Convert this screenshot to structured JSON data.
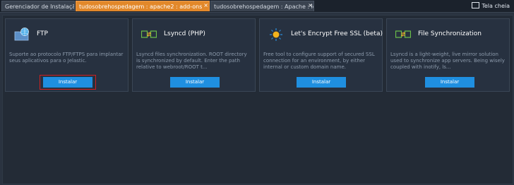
{
  "tabs": [
    {
      "label": "Gerenciador de Instalação",
      "active": false,
      "closable": false
    },
    {
      "label": "tudosobrehospedagem : apache2 : add-ons",
      "active": true,
      "closable": true
    },
    {
      "label": "tudosobrehospedagem : Apache : log",
      "active": false,
      "closable": true
    }
  ],
  "close_glyph": "×",
  "fullscreen_label": "Tela cheia",
  "addons": [
    {
      "title": "FTP",
      "description": "Suporte ao protocolo FTP/FTPS para implantar seus aplicativos para o Jelastic.",
      "button": "Instalar",
      "icon": "ftp-folder-globe-icon"
    },
    {
      "title": "Lsyncd (PHP)",
      "description": "Lsyncd files synchronization. ROOT directory is synchronized by default. Enter the path relative to webroot/ROOT t...",
      "button": "Instalar",
      "icon": "sync-folders-icon"
    },
    {
      "title": "Let's Encrypt Free SSL (beta)",
      "description": "Free tool to configure support of secured SSL connection for an environment, by either internal or custom domain name.",
      "button": "Instalar",
      "icon": "sun-icon"
    },
    {
      "title": "File Synchronization",
      "description": "Lsyncd is a light-weight, live mirror solution used to synchronize app servers. Being wisely coupled with inotify, ls...",
      "button": "Instalar",
      "icon": "sync-folders-icon"
    }
  ],
  "colors": {
    "active_tab": "#e2882a",
    "button": "#1f8fe0",
    "highlight": "#d02020"
  }
}
